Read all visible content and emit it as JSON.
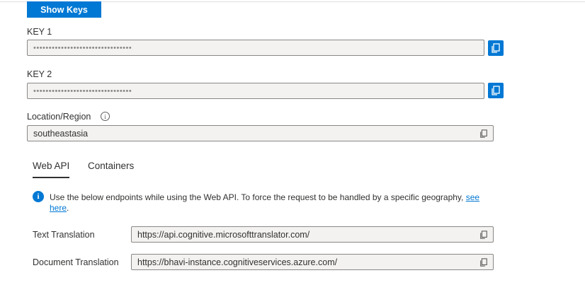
{
  "show_keys_label": "Show Keys",
  "key1": {
    "label": "KEY 1",
    "value": "••••••••••••••••••••••••••••••••"
  },
  "key2": {
    "label": "KEY 2",
    "value": "••••••••••••••••••••••••••••••••"
  },
  "region": {
    "label": "Location/Region",
    "value": "southeastasia"
  },
  "tabs": [
    {
      "label": "Web API",
      "active": true
    },
    {
      "label": "Containers",
      "active": false
    }
  ],
  "info": {
    "text": "Use the below endpoints while using the Web API. To force the request to be handled by a specific geography,",
    "link_text_1": "see",
    "link_text_2": "here",
    "trailing": "."
  },
  "endpoints": [
    {
      "label": "Text Translation",
      "value": "https://api.cognitive.microsofttranslator.com/"
    },
    {
      "label": "Document Translation",
      "value": "https://bhavi-instance.cognitiveservices.azure.com/"
    }
  ],
  "colors": {
    "accent": "#0078d4",
    "field_bg": "#f3f2f1",
    "border": "#8a8886"
  },
  "icons": {
    "copy": "copy-icon",
    "info": "info-icon"
  }
}
